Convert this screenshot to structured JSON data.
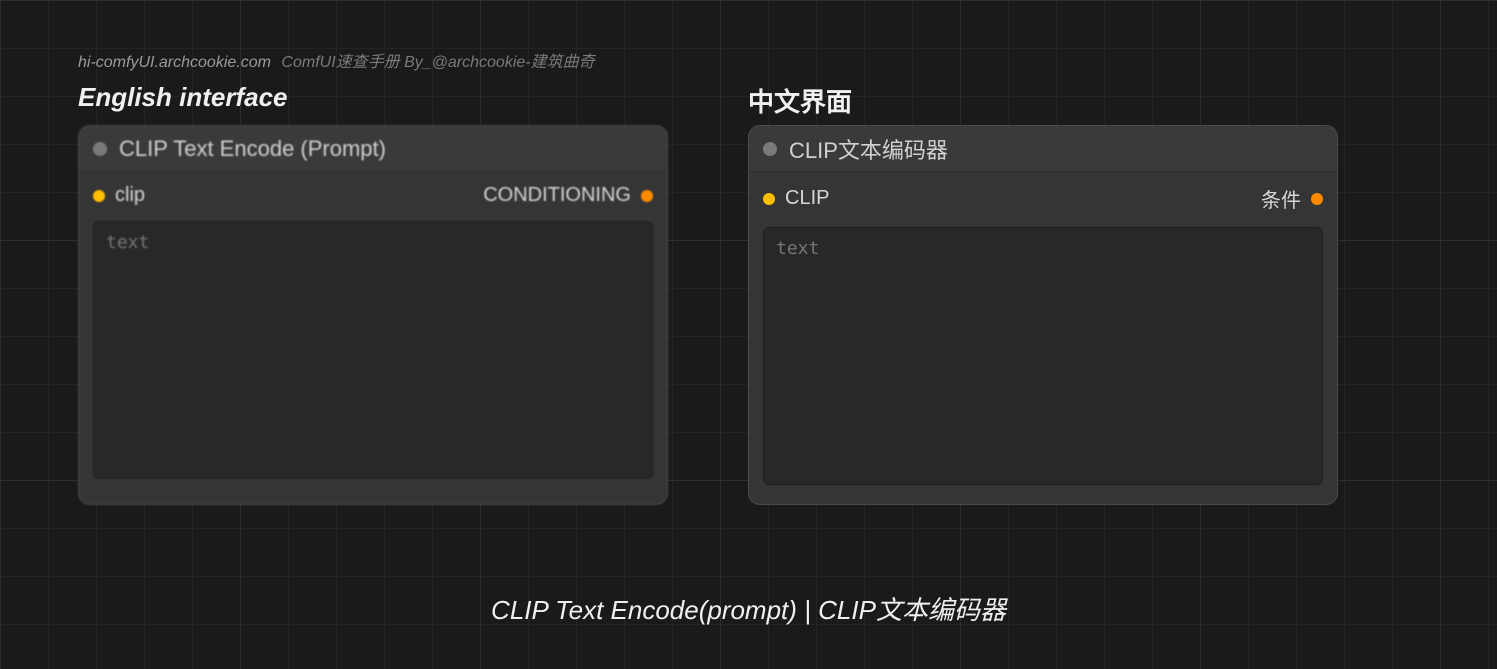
{
  "watermark": {
    "site": "hi-comfyUI.archcookie.com",
    "credit": "ComfUI速查手册 By_@archcookie-建筑曲奇"
  },
  "labels": {
    "english": "English interface",
    "chinese": "中文界面"
  },
  "node_en": {
    "title": "CLIP Text Encode (Prompt)",
    "input_label": "clip",
    "output_label": "CONDITIONING",
    "text_placeholder": "text",
    "text_value": ""
  },
  "node_cn": {
    "title": "CLIP文本编码器",
    "input_label": "CLIP",
    "output_label": "条件",
    "text_placeholder": "text",
    "text_value": ""
  },
  "caption": "CLIP Text Encode(prompt)  | CLIP文本编码器",
  "colors": {
    "input_port": "#ffbe00",
    "output_port": "#ff8a00"
  }
}
